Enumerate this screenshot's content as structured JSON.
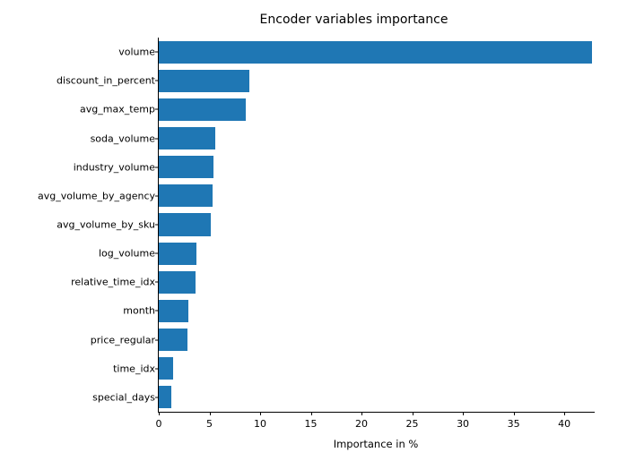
{
  "chart_data": {
    "type": "bar",
    "orientation": "horizontal",
    "title": "Encoder variables importance",
    "xlabel": "Importance in %",
    "ylabel": "",
    "xlim": [
      0,
      43
    ],
    "categories": [
      "volume",
      "discount_in_percent",
      "avg_max_temp",
      "soda_volume",
      "industry_volume",
      "avg_volume_by_agency",
      "avg_volume_by_sku",
      "log_volume",
      "relative_time_idx",
      "month",
      "price_regular",
      "time_idx",
      "special_days"
    ],
    "values": [
      42.7,
      8.9,
      8.6,
      5.6,
      5.4,
      5.3,
      5.1,
      3.7,
      3.6,
      2.9,
      2.8,
      1.4,
      1.2
    ],
    "xticks": [
      0,
      5,
      10,
      15,
      20,
      25,
      30,
      35,
      40
    ],
    "bar_color": "#1f77b4"
  }
}
